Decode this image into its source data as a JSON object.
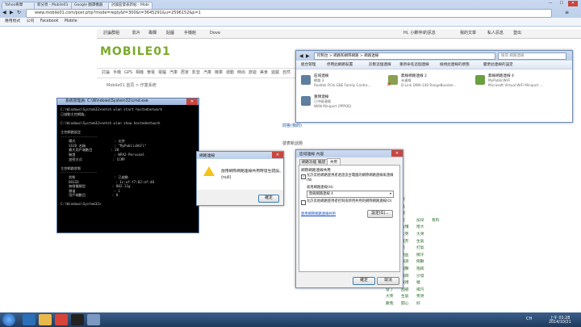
{
  "browser": {
    "tabs": [
      {
        "label": "Yahoo奇摩"
      },
      {
        "label": "新分頁 - Mobile01"
      },
      {
        "label": "Google 翻譯機器"
      },
      {
        "label": "討論區發表新帖 - Mobi"
      }
    ],
    "url": "www.mobile01.com/post.php?mode=reply&f=300&t=3645291&u=2596152&p=1",
    "bookmarks": [
      "應用程式",
      "公司",
      "Facebook",
      "Mobile"
    ]
  },
  "site": {
    "top_nav": [
      "討論群組",
      "影片",
      "專欄",
      "貼圖",
      "手機館",
      "Dove"
    ],
    "user_links": [
      "Hi, 小夥伴I的訊息",
      "我的文章",
      "私人訊息",
      "登出"
    ],
    "logo": "MOBILE01",
    "categories": [
      "討論",
      "手機",
      "GPS",
      "相機",
      "筆電",
      "電腦",
      "汽車",
      "居家",
      "影音",
      "汽車",
      "機車",
      "運動",
      "時尚",
      "旅遊",
      "美食",
      "遊戲",
      "自然",
      "生活"
    ],
    "breadcrumb": "Mobile01 首頁 > 作業系統",
    "fragments": [
      "問答(我的)",
      "發表新話題",
      "便利"
    ],
    "emoji_words": [
      [
        "揮",
        "哭"
      ],
      [
        "揮",
        "鬼"
      ],
      [
        "揮",
        "觸"
      ],
      [
        "沙",
        "笑",
        "加深",
        "有料"
      ],
      [
        "吐舌",
        "含懂",
        "哈大"
      ],
      [
        "撒嬌",
        "大笑",
        "大哭"
      ],
      [
        "偷笑",
        "無奈",
        "生氣"
      ],
      [
        "瞪眼",
        "笑",
        "打氣"
      ],
      [
        "欠撞",
        "熱血",
        "擦汗"
      ],
      [
        "冷笑",
        "眼淚",
        "倒數"
      ],
      [
        "偷看",
        "喝聲",
        "抱病"
      ],
      [
        "飛天",
        "飛吻",
        "沙發"
      ],
      [
        "困難",
        "敬禮",
        "噓"
      ],
      [
        "發了",
        "困惑",
        "喝汽"
      ],
      [
        "大笑",
        "生氣",
        "笑哭"
      ],
      [
        "數我",
        "開心",
        "好"
      ]
    ]
  },
  "explorer": {
    "breadcrumb": "控制台 > 網路和網際網路 > 網路連線",
    "search_placeholder": "搜尋 網路連線",
    "toolbar": [
      "組合管理",
      "停用此網路裝置",
      "診斷這個連線",
      "重新命名這個連線",
      "檢視此連線的狀態",
      "變更此連線的設定"
    ],
    "connections": [
      {
        "name": "區域連線",
        "status": "網路 3",
        "device": "Realtek PCIe GBE Family Contro..."
      },
      {
        "name": "無線網路連線 2",
        "status": "未連線",
        "device": "D-Link DWA-140 RangeBooster..."
      },
      {
        "name": "無線網路連線 4",
        "status": "MyPublicWiFi",
        "device": "Microsoft Virtual WiFi Miniport ..."
      },
      {
        "name": "寬頻連線",
        "status": "已中斷連線",
        "device": "WAN Miniport (PPPOE)"
      }
    ]
  },
  "cmd": {
    "title": "系統管理員: C:\\Windows\\System32\\cmd.exe",
    "lines": [
      "C:\\Windows\\System32>netsh wlan start hostednetwork",
      "已啟動主控網路。",
      "",
      "C:\\Windows\\System32>netsh wlan show hostednetwork",
      "",
      "主控網路設定",
      "------------------",
      "    模式                   : 允許",
      "    SSID 名稱              : \"MyPublicWiFi\"",
      "    最大用戶端數目         : 20",
      "    驗證                   : WPA2-Personal",
      "    加密方式               : CCMP",
      "",
      "主控網路狀態",
      "------------------",
      "    狀態                   : 已啟動",
      "    BSSID                  : 1c:af:f7:82:af:48",
      "    無線電類型             : 802.11g",
      "    頻道                   : 1",
      "    用戶端數目             : 0",
      "",
      "C:\\Windows\\System32>"
    ]
  },
  "dialog": {
    "title": "網路連線",
    "message": "啟用網際網路連線共用時發生錯誤。",
    "code": "(null)",
    "ok": "確定"
  },
  "props": {
    "title": "區域連線 內容",
    "tabs": [
      "網路功能",
      "驗證",
      "共用"
    ],
    "section": "網際網路連線共用",
    "check1": "允許其他網路使用者透過這台電腦的網際網路連線來連線(N)",
    "home_label": "家用網路連線(H):",
    "home_value": "無線網路連線 4",
    "check2": "允許其他網路使用者控制或停用共用的網際網路連線(O)",
    "link": "使用網際網路連線共用",
    "settings_btn": "設定(G)...",
    "ok": "確定",
    "cancel": "取消"
  },
  "taskbar": {
    "time": "上午 01:28",
    "date": "2014/10/21",
    "lang": "CH"
  },
  "colors": {
    "logo_green": "#7aaa2b",
    "taskbar": "#1f3b5e"
  }
}
